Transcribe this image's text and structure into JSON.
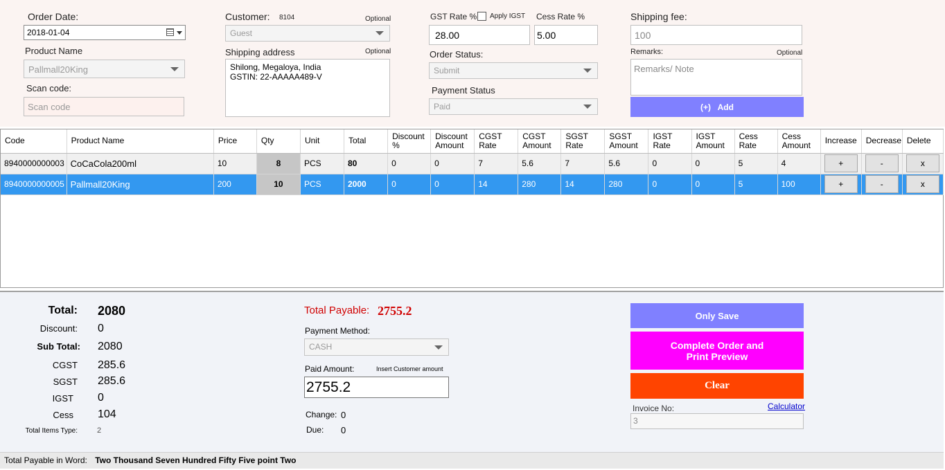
{
  "order_date": {
    "label": "Order Date:",
    "value": "2018-01-04"
  },
  "product_name": {
    "label": "Product Name",
    "value": "Pallmall20King"
  },
  "scan_code": {
    "label": "Scan code:",
    "placeholder": "Scan code"
  },
  "customer": {
    "label": "Customer:",
    "id": "8104",
    "optional": "Optional",
    "value": "Guest"
  },
  "shipping_address": {
    "label": "Shipping address",
    "optional": "Optional",
    "line1": "Shilong, Megaloya, India",
    "line2": "GSTIN: 22-AAAAA489-V"
  },
  "gst": {
    "label": "GST Rate %",
    "value": "28.00",
    "apply_igst": "Apply IGST"
  },
  "cess": {
    "label": "Cess Rate %",
    "value": "5.00"
  },
  "order_status": {
    "label": "Order Status:",
    "value": "Submit"
  },
  "payment_status": {
    "label": "Payment Status",
    "value": "Paid"
  },
  "shipping_fee": {
    "label": "Shipping fee:",
    "value": "100"
  },
  "remarks": {
    "label": "Remarks:",
    "optional": "Optional",
    "placeholder": "Remarks/ Note"
  },
  "add_button": {
    "label": "(+)   Add"
  },
  "table": {
    "headers": [
      "Code",
      "Product Name",
      "Price",
      "Qty",
      "Unit",
      "Total",
      "Discount %",
      "Discount Amount",
      "CGST Rate",
      "CGST Amount",
      "SGST Rate",
      "SGST Amount",
      "IGST Rate",
      "IGST Amount",
      "Cess Rate",
      "Cess Amount",
      "Increase",
      "Decrease",
      "Delete"
    ],
    "rows": [
      {
        "code": "8940000000003",
        "name": "CoCaCola200ml",
        "price": "10",
        "qty": "8",
        "unit": "PCS",
        "total": "80",
        "disc_pct": "0",
        "disc_amt": "0",
        "cgst_rate": "7",
        "cgst_amt": "5.6",
        "sgst_rate": "7",
        "sgst_amt": "5.6",
        "igst_rate": "0",
        "igst_amt": "0",
        "cess_rate": "5",
        "cess_amt": "4",
        "inc": "+",
        "dec": "-",
        "del": "x"
      },
      {
        "code": "8940000000005",
        "name": "Pallmall20King",
        "price": "200",
        "qty": "10",
        "unit": "PCS",
        "total": "2000",
        "disc_pct": "0",
        "disc_amt": "0",
        "cgst_rate": "14",
        "cgst_amt": "280",
        "sgst_rate": "14",
        "sgst_amt": "280",
        "igst_rate": "0",
        "igst_amt": "0",
        "cess_rate": "5",
        "cess_amt": "100",
        "inc": "+",
        "dec": "-",
        "del": "x"
      }
    ]
  },
  "summary": {
    "total_label": "Total:",
    "total": "2080",
    "discount_label": "Discount:",
    "discount": "0",
    "subtotal_label": "Sub Total:",
    "subtotal": "2080",
    "cgst_label": "CGST",
    "cgst": "285.6",
    "sgst_label": "SGST",
    "sgst": "285.6",
    "igst_label": "IGST",
    "igst": "0",
    "cess_label": "Cess",
    "cess": "104",
    "items_type_label": "Total Items Type:",
    "items_type": "2"
  },
  "payment": {
    "total_payable_label": "Total Payable:",
    "total_payable": "2755.2",
    "method_label": "Payment Method:",
    "method": "CASH",
    "paid_label": "Paid Amount:",
    "paid_hint": "Insert Customer amount",
    "paid": "2755.2",
    "change_label": "Change:",
    "change": "0",
    "due_label": "Due:",
    "due": "0"
  },
  "actions": {
    "only_save": "Only Save",
    "complete_line1": "Complete Order and",
    "complete_line2": "Print Preview",
    "clear": "Clear",
    "invoice_label": "Invoice No:",
    "calculator": "Calculator",
    "invoice_no": "3"
  },
  "footer": {
    "label": "Total Payable in Word:",
    "words": "Two Thousand Seven Hundred Fifty Five point Two"
  },
  "colors": {
    "add_btn": "#8080ff",
    "only_save": "#8080ff",
    "complete": "#ff00ff",
    "clear": "#ff4400",
    "selected_row": "#3398f0",
    "payable": "#d00000"
  }
}
